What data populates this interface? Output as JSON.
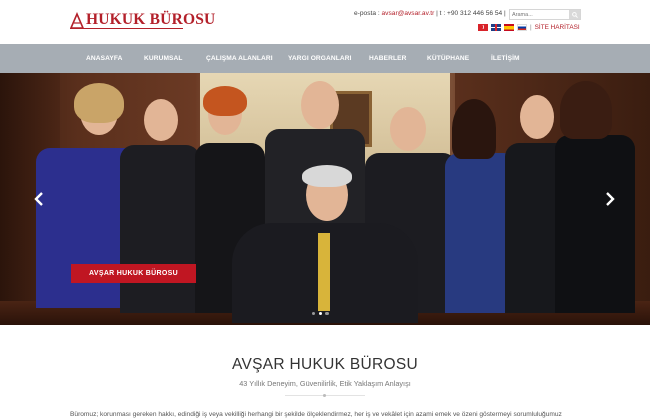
{
  "header": {
    "logo_text": "HUKUK BÜROSU",
    "contact_label": "e-posta :",
    "email": "avsar@avsar.av.tr",
    "separator": "|",
    "phone_label": "t :",
    "phone": "+90 312 446 56 54",
    "search_placeholder": "Arama...",
    "sitemap_label": "SİTE HARİTASI",
    "languages": [
      "tr-flag-icon",
      "en-flag-icon",
      "es-flag-icon",
      "ru-flag-icon"
    ]
  },
  "nav": {
    "items": [
      {
        "label": "ANASAYFA"
      },
      {
        "label": "KURUMSAL"
      },
      {
        "label": "ÇALIŞMA ALANLARI"
      },
      {
        "label": "YARGI ORGANLARI"
      },
      {
        "label": "HABERLER"
      },
      {
        "label": "KÜTÜPHANE"
      },
      {
        "label": "İLETİŞİM"
      }
    ]
  },
  "hero": {
    "cta_label": "AVŞAR HUKUK BÜROSU",
    "slide_count": 3,
    "active_slide": 2
  },
  "content": {
    "title": "AVŞAR HUKUK BÜROSU",
    "subtitle": "43 Yıllık Deneyim, Güvenilirlik, Etik Yaklaşım Anlayışı",
    "body": "Büromuz; korunması gereken hakkı, edindiği iş veya vekilliği herhangi bir şekilde ölçeklendirmez, her iş ve vekâlet için azami emek ve özeni göstermeyi sorumluluğumuz"
  },
  "colors": {
    "brand_red": "#b3202a",
    "nav_bg": "#a6adb4",
    "cta_bg": "#c01622"
  }
}
